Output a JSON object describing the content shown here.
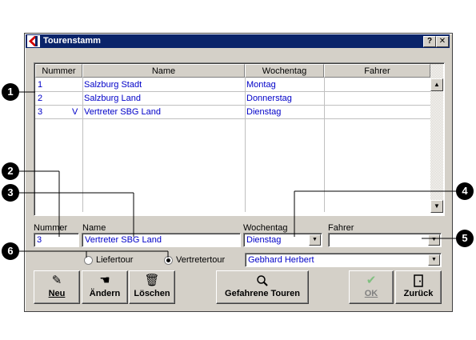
{
  "window": {
    "title": "Tourenstamm",
    "help_label": "?",
    "close_label": "✕"
  },
  "grid": {
    "columns": [
      "Nummer",
      "Name",
      "Wochentag",
      "Fahrer"
    ],
    "rows": [
      {
        "nummer": "1",
        "flag": "",
        "name": "Salzburg Stadt",
        "wochentag": "Montag",
        "fahrer": ""
      },
      {
        "nummer": "2",
        "flag": "",
        "name": "Salzburg Land",
        "wochentag": "Donnerstag",
        "fahrer": ""
      },
      {
        "nummer": "3",
        "flag": "V",
        "name": "Vertreter SBG Land",
        "wochentag": "Dienstag",
        "fahrer": ""
      }
    ]
  },
  "form": {
    "nummer_label": "Nummer",
    "nummer_value": "3",
    "name_label": "Name",
    "name_value": "Vertreter SBG Land",
    "wochentag_label": "Wochentag",
    "wochentag_value": "Dienstag",
    "fahrer_label": "Fahrer",
    "fahrer_value": "",
    "radio_liefertour": "Liefertour",
    "radio_vertretertour": "Vertretertour",
    "radio_selected": "vertretertour",
    "vertreter_value": "Gebhard Herbert"
  },
  "toolbar": {
    "neu": "Neu",
    "aendern": "Ändern",
    "loeschen": "Löschen",
    "gefahrene": "Gefahrene Touren",
    "ok": "OK",
    "zurueck": "Zurück"
  },
  "callouts": [
    "1",
    "2",
    "3",
    "4",
    "5",
    "6"
  ],
  "icons": {
    "neu": "pencil-icon",
    "aendern": "hand-edit-icon",
    "loeschen": "trash-icon",
    "gefahrene": "magnifier-icon",
    "ok": "checkmark-icon",
    "zurueck": "door-exit-icon",
    "app": "app-logo-icon"
  },
  "colors": {
    "titlebar": "#0a246a",
    "data_text": "#0000c8",
    "face": "#d4d0c8"
  }
}
